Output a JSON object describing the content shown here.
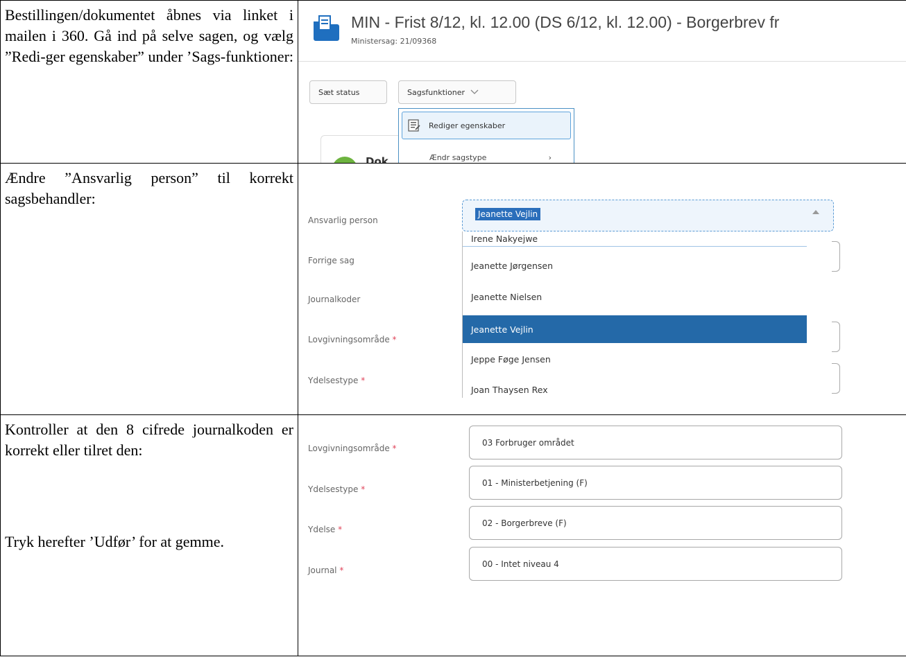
{
  "instructions": [
    "Bestillingen/dokumentet åbnes via linket i mailen i 360. Gå ind på selve sagen, og vælg ”Redi-ger egenskaber” under ’Sags-funktioner:",
    "Ændre ”Ansvarlig person” til korrekt sagsbehandler:",
    "Kontroller at den 8 cifrede journalkoden er korrekt eller tilret den:",
    "Tryk herefter ’Udfør’ for at gemme."
  ],
  "case_view": {
    "title": "MIN - Frist 8/12, kl. 12.00 (DS 6/12, kl. 12.00) - Borgerbrev fr",
    "subtitle": "Ministersag: 21/09368",
    "buttons": {
      "set_status": "Sæt status",
      "case_functions": "Sagsfunktioner"
    },
    "menu": {
      "edit_properties": "Rediger egenskaber",
      "change_case_type": "Ændr sagstype"
    },
    "doc_card_text": "Dok",
    "colors": {
      "icon_blue": "#1f6fbf",
      "menu_border": "#4a90c4",
      "doc_green": "#6db33f"
    }
  },
  "responsible_form": {
    "labels": {
      "responsible": "Ansvarlig person",
      "previous_case": "Forrige sag",
      "journal_codes": "Journalkoder",
      "legislation": "Lovgivningsområde",
      "benefit_type": "Ydelsestype"
    },
    "required_mark": "*",
    "selected_value": "Jeanette Vejlin",
    "options": [
      "Irene Nakyejwe",
      "Jeanette Jørgensen",
      "Jeanette Nielsen",
      "Jeanette Vejlin",
      "Jeppe Føge Jensen",
      "Joan Thaysen Rex"
    ],
    "selected_option": "Jeanette Vejlin",
    "colors": {
      "selection_bg": "#2469a8",
      "required": "#e0445a"
    }
  },
  "journal_form": {
    "fields": [
      {
        "label": "Lovgivningsområde",
        "value": "03 Forbruger området"
      },
      {
        "label": "Ydelsestype",
        "value": "01 - Ministerbetjening (F)"
      },
      {
        "label": "Ydelse",
        "value": "02 - Borgerbreve (F)"
      },
      {
        "label": "Journal",
        "value": "00 - Intet niveau 4"
      }
    ],
    "required_mark": "*"
  }
}
